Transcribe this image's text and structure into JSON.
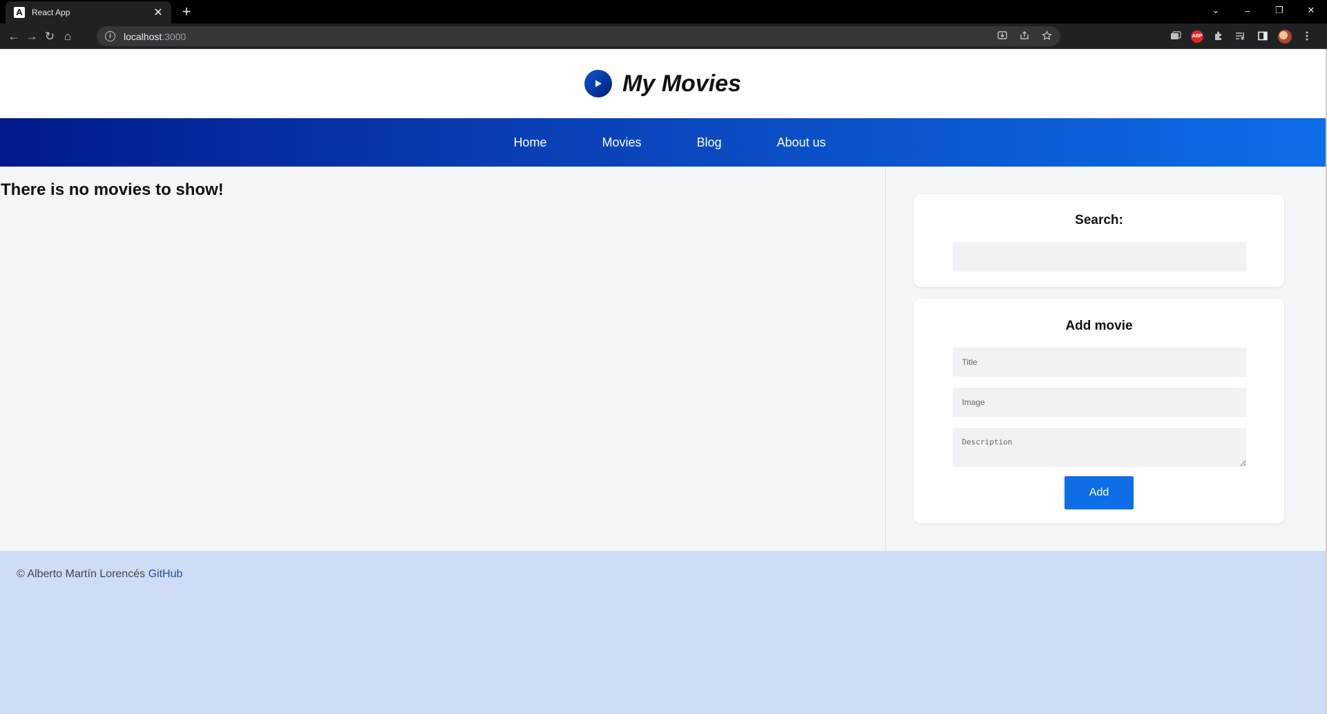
{
  "browser": {
    "tab": {
      "favicon": "A",
      "title": "React App",
      "close": "✕"
    },
    "new_tab": "+",
    "window_controls": {
      "tab_search": "⌄",
      "minimize": "–",
      "restore": "❐",
      "close": "✕"
    },
    "nav": {
      "back": "←",
      "forward": "→",
      "reload": "↻",
      "home": "⌂"
    },
    "info": "i",
    "url": {
      "host": "localhost",
      "port": ":3000"
    },
    "abp_label": "ABP"
  },
  "header": {
    "title": "My Movies"
  },
  "nav": {
    "items": [
      "Home",
      "Movies",
      "Blog",
      "About us"
    ]
  },
  "main": {
    "empty_message": "There is no movies to show!"
  },
  "search": {
    "heading": "Search:",
    "value": ""
  },
  "add_movie": {
    "heading": "Add movie",
    "title_placeholder": "Title",
    "image_placeholder": "Image",
    "description_placeholder": "Description",
    "button_label": "Add"
  },
  "footer": {
    "text": "© Alberto Martín Lorencés",
    "link": "GitHub"
  },
  "colors": {
    "nav_gradient_start": "#001a8c",
    "nav_gradient_end": "#0d6ee8",
    "button": "#0d6ee8",
    "footer_bg": "#cfdcf5",
    "content_bg": "#f5f6f8"
  }
}
